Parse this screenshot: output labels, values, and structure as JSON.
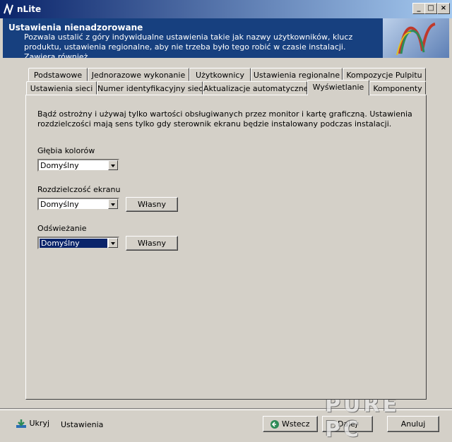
{
  "window": {
    "title": "nLite"
  },
  "header": {
    "title": "Ustawienia nienadzorowane",
    "description": "Pozwala ustalić z góry indywidualne ustawienia takie jak nazwy użytkowników, klucz produktu, ustawienia regionalne, aby nie trzeba było tego robić w czasie instalacji. Zawiera również"
  },
  "tabs_row1": [
    "Podstawowe",
    "Jednorazowe wykonanie",
    "Użytkownicy",
    "Ustawienia regionalne",
    "Kompozycje Pulpitu"
  ],
  "tabs_row2": [
    "Ustawienia sieci",
    "Numer identyfikacyjny sieci",
    "Aktualizacje automatyczne",
    "Wyświetlanie",
    "Komponenty"
  ],
  "active_tab": "Wyświetlanie",
  "panel": {
    "note": "Bądź ostrożny i używaj tylko wartości obsługiwanych przez monitor i kartę graficzną. Ustawienia rozdzielczości mają sens tylko gdy sterownik ekranu będzie instalowany podczas instalacji.",
    "color_depth": {
      "label": "Głębia kolorów",
      "value": "Domyślny"
    },
    "resolution": {
      "label": "Rozdzielczość ekranu",
      "value": "Domyślny",
      "button": "Własny"
    },
    "refresh": {
      "label": "Odświeżanie",
      "value": "Domyślny",
      "button": "Własny"
    }
  },
  "bottom": {
    "hide_label": "Ukryj",
    "settings_label": "Ustawienia",
    "back_label": "Wstecz",
    "next_label": "Dalej",
    "cancel_label": "Anuluj"
  },
  "watermark": "PURE PC"
}
